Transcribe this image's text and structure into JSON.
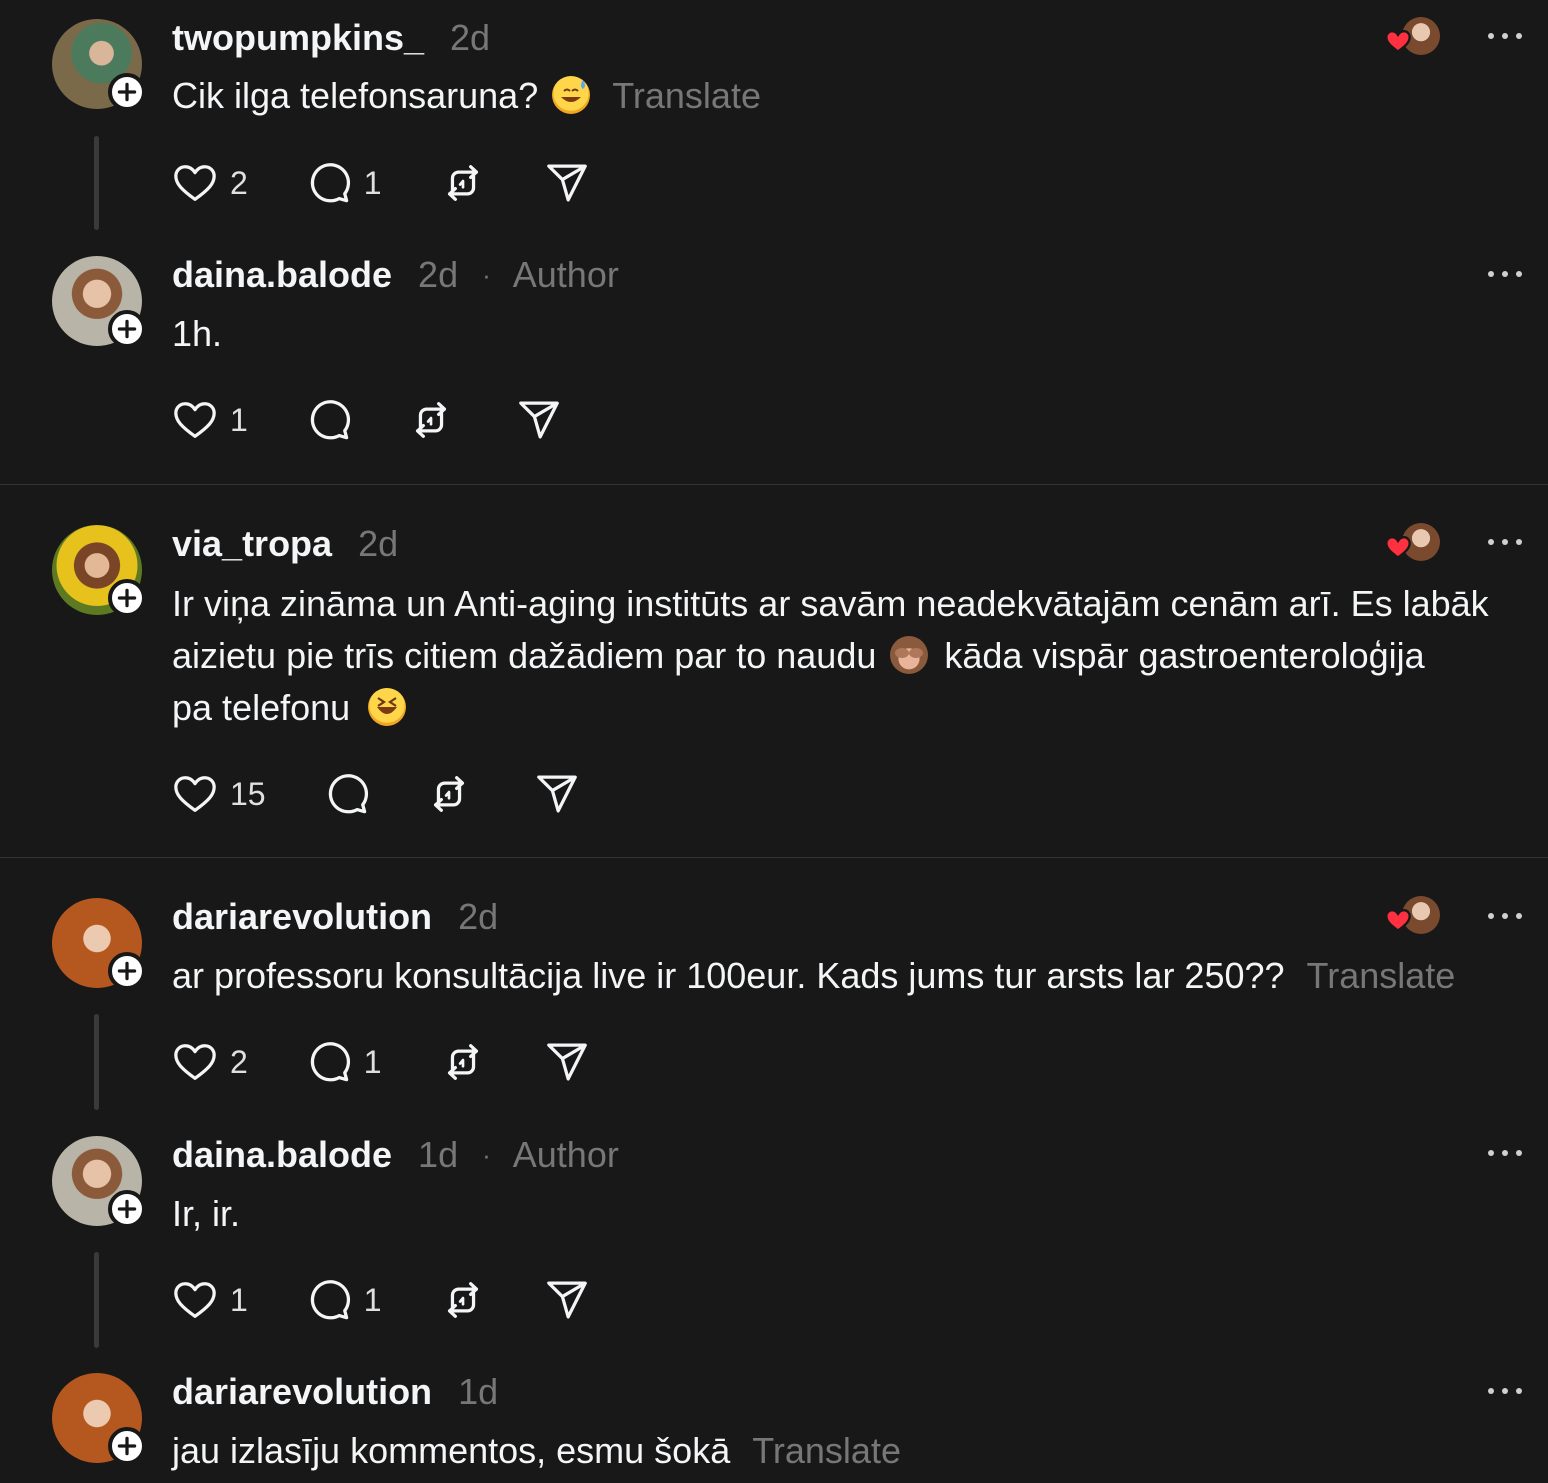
{
  "colors": {
    "background": "#181818",
    "primary_text": "#f3f5f7",
    "secondary_text": "#777777",
    "heart": "#ff3040"
  },
  "icons": {
    "like": "heart-outline-icon",
    "reply": "speech-bubble-icon",
    "repost": "repost-icon",
    "share": "send-icon",
    "more": "ellipsis-icon",
    "follow": "plus-icon",
    "liked_by_author": "heart-filled-icon"
  },
  "posts": [
    {
      "username": "twopumpkins_",
      "time": "2d",
      "author_badge": "",
      "text": "Cik ilga telefonsaruna?",
      "translate": "Translate",
      "likes": "2",
      "replies": "1",
      "liked_by_author": true
    },
    {
      "username": "daina.balode",
      "time": "2d",
      "author_badge": "Author",
      "text": "1h.",
      "translate": "",
      "likes": "1",
      "replies": "",
      "liked_by_author": false
    },
    {
      "username": "via_tropa",
      "time": "2d",
      "author_badge": "",
      "text_line1": "Ir viņa zināma un Anti-aging institūts ar savām neadekvātajām cenām arī. Es labāk",
      "text_line2a": "aizietu pie trīs citiem dažādiem par to naudu",
      "text_line2b": "kāda vispār gastroenteroloģija",
      "text_line3": "pa telefonu",
      "likes": "15",
      "replies": "",
      "liked_by_author": true
    },
    {
      "username": "dariarevolution",
      "time": "2d",
      "author_badge": "",
      "text": "ar professoru konsultācija live ir 100eur. Kads jums tur arsts lar 250??",
      "translate": "Translate",
      "likes": "2",
      "replies": "1",
      "liked_by_author": true
    },
    {
      "username": "daina.balode",
      "time": "1d",
      "author_badge": "Author",
      "text": "Ir, ir.",
      "translate": "",
      "likes": "1",
      "replies": "1",
      "liked_by_author": false
    },
    {
      "username": "dariarevolution",
      "time": "1d",
      "author_badge": "",
      "text": "jau izlasīju kommentos, esmu šokā",
      "translate": "Translate",
      "likes": "",
      "replies": "",
      "liked_by_author": false
    }
  ],
  "separator_dot": "·"
}
